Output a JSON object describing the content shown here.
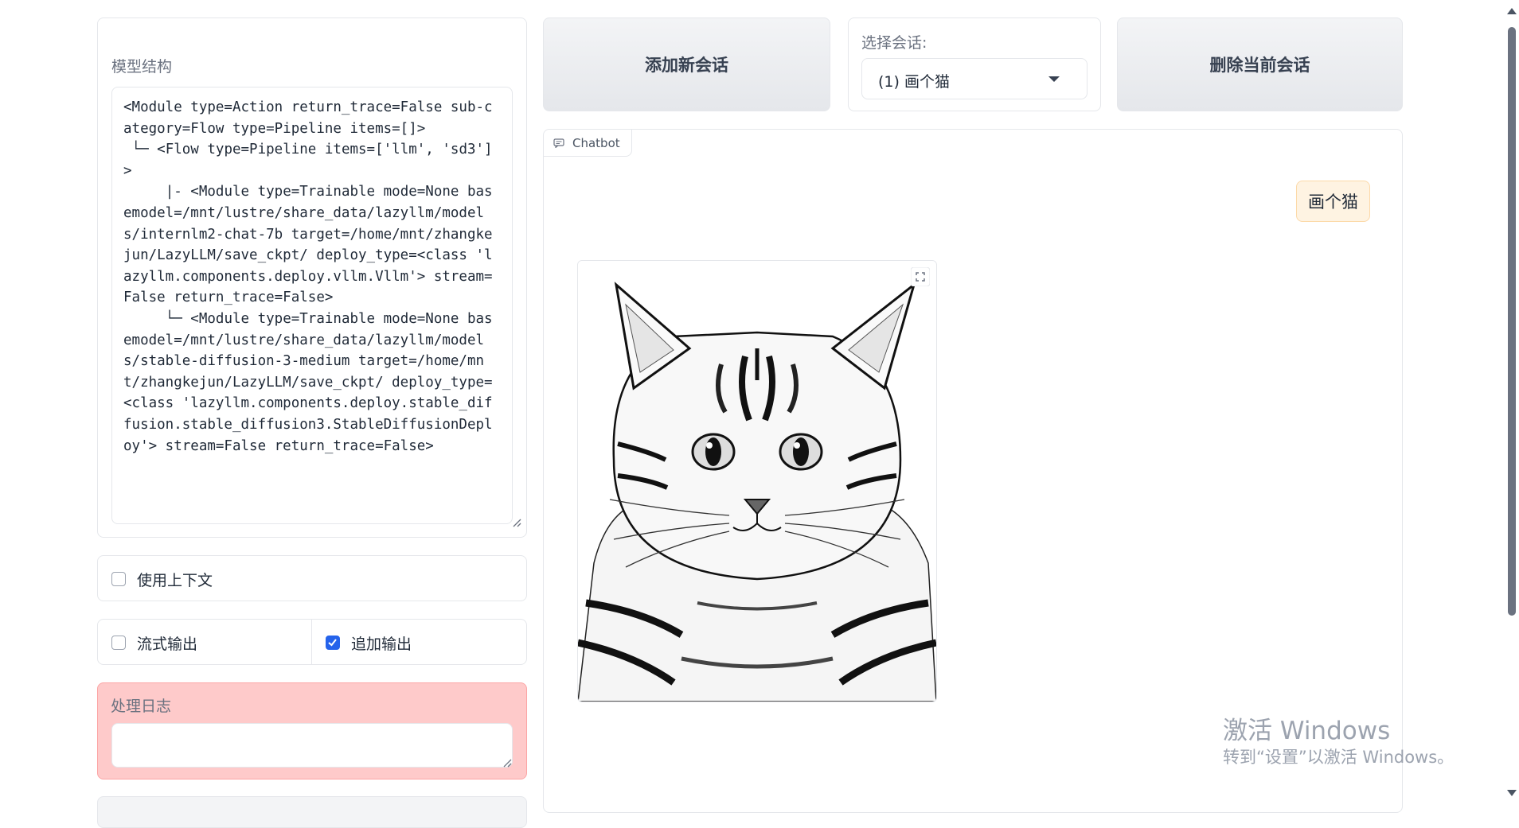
{
  "model_structure": {
    "label": "模型结构",
    "text": "<Module type=Action return_trace=False sub-category=Flow type=Pipeline items=[]>\n └─ <Flow type=Pipeline items=['llm', 'sd3']>\n     |- <Module type=Trainable mode=None basemodel=/mnt/lustre/share_data/lazyllm/models/internlm2-chat-7b target=/home/mnt/zhangkejun/LazyLLM/save_ckpt/ deploy_type=<class 'lazyllm.components.deploy.vllm.Vllm'> stream=False return_trace=False>\n     └─ <Module type=Trainable mode=None basemodel=/mnt/lustre/share_data/lazyllm/models/stable-diffusion-3-medium target=/home/mnt/zhangkejun/LazyLLM/save_ckpt/ deploy_type=<class 'lazyllm.components.deploy.stable_diffusion.stable_diffusion3.StableDiffusionDeploy'> stream=False return_trace=False>"
  },
  "options": {
    "use_context": {
      "label": "使用上下文",
      "checked": false
    },
    "stream_output": {
      "label": "流式输出",
      "checked": false
    },
    "append_output": {
      "label": "追加输出",
      "checked": true
    }
  },
  "log": {
    "label": "处理日志",
    "value": ""
  },
  "toolbar": {
    "add_session": "添加新会话",
    "delete_session": "删除当前会话",
    "select_label": "选择会话:",
    "selected_session": "(1) 画个猫"
  },
  "chatbot": {
    "tab_label": "Chatbot",
    "user_message": "画个猫"
  },
  "watermark": {
    "title": "激活 Windows",
    "subtitle": "转到“设置”以激活 Windows。"
  },
  "colors": {
    "accent": "#2563eb",
    "log_bg": "#fecaca",
    "bubble_bg": "#fef3e2"
  },
  "icons": {
    "chat_tab": "chat-bubble-icon",
    "expand": "fullscreen-icon",
    "dropdown": "chevron-down-icon"
  }
}
